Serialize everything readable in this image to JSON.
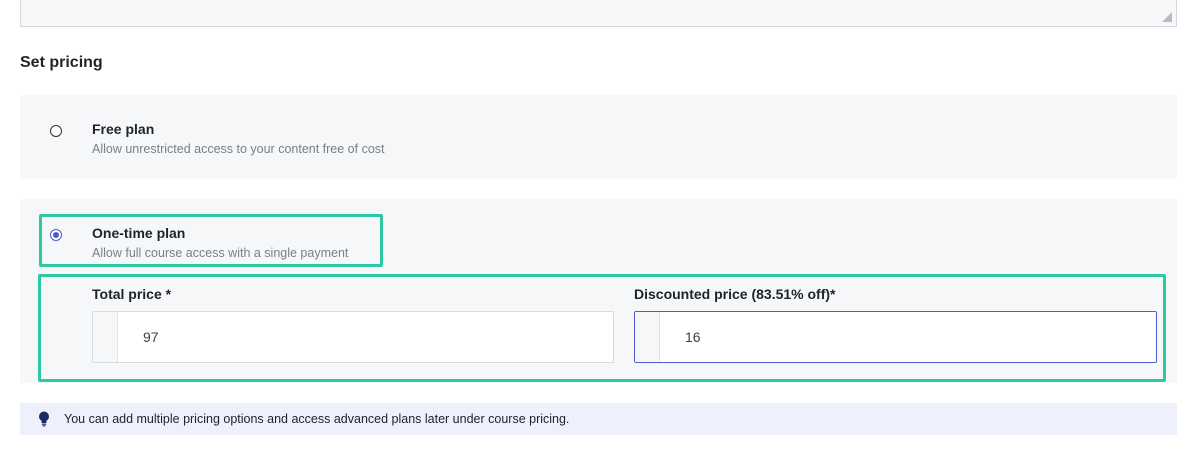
{
  "section_title": "Set pricing",
  "plans": [
    {
      "title": "Free plan",
      "description": "Allow unrestricted access to your content free of cost",
      "selected": false
    },
    {
      "title": "One-time plan",
      "description": "Allow full course access with a single payment",
      "selected": true
    }
  ],
  "pricing_fields": {
    "total_price_label": "Total price *",
    "total_price_value": "97",
    "discounted_price_label": "Discounted price (83.51% off)*",
    "discounted_price_value": "16"
  },
  "info_banner": {
    "icon": "lightbulb-icon",
    "text": "You can add multiple pricing options and access advanced plans later under course pricing."
  },
  "colors": {
    "accent": "#4f5bd5",
    "highlight_outline": "#2ec9a4",
    "card_background": "#f6f7f8",
    "banner_background": "#eef0fc"
  }
}
